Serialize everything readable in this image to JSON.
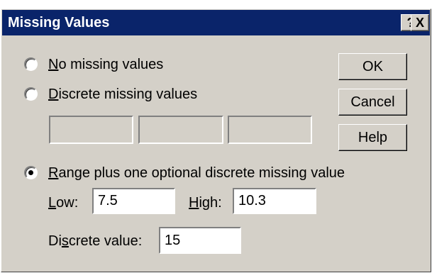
{
  "dialog": {
    "title": "Missing Values",
    "help_glyph": "?",
    "close_glyph": "X"
  },
  "options": {
    "no_missing": {
      "accel": "N",
      "rest": "o missing values",
      "selected": false
    },
    "discrete": {
      "accel": "D",
      "rest": "iscrete missing values",
      "selected": false
    },
    "range": {
      "accel": "R",
      "rest": "ange plus one optional discrete missing value",
      "selected": true
    }
  },
  "discrete_fields": [
    "",
    "",
    ""
  ],
  "range": {
    "low_accel": "L",
    "low_rest": "ow:",
    "low_value": "7.5",
    "high_accel": "H",
    "high_rest": "igh:",
    "high_value": "10.3",
    "discrete_pre": "Di",
    "discrete_accel": "s",
    "discrete_post": "crete value:",
    "discrete_value": "15"
  },
  "buttons": {
    "ok": "OK",
    "cancel": "Cancel",
    "help": "Help"
  },
  "icons": {
    "radio_empty": "radio-unselected-icon",
    "radio_filled": "radio-selected-icon"
  },
  "colors": {
    "titlebar": "#0a246a",
    "face": "#d4d0c8"
  }
}
